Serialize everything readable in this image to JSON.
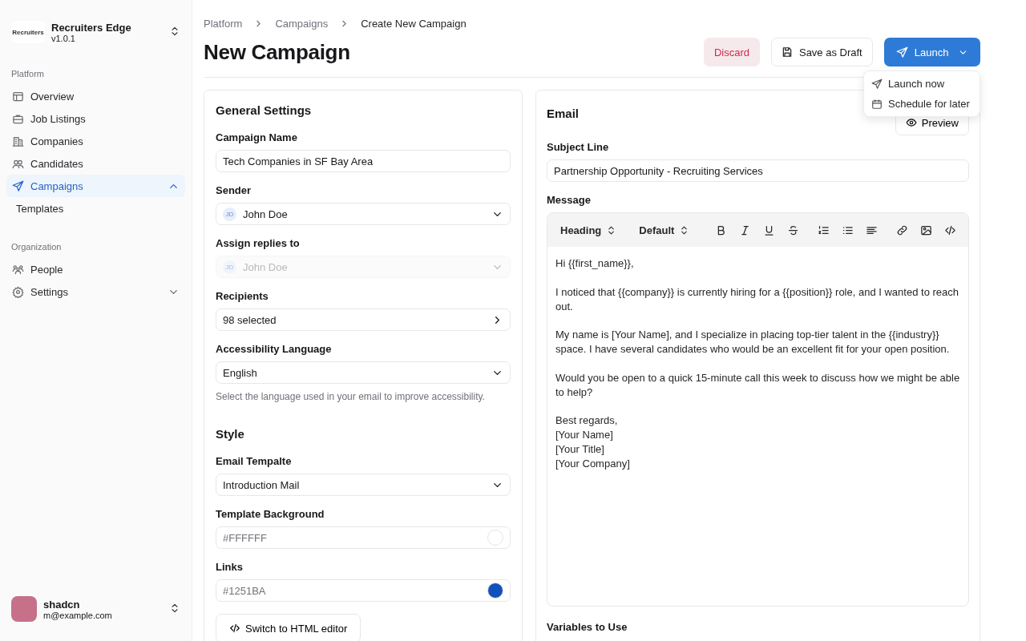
{
  "sidebar": {
    "team": {
      "logo_text": "Recruiters",
      "name": "Recruiters Edge",
      "version": "v1.0.1"
    },
    "groups": [
      {
        "label": "Platform",
        "items": [
          {
            "label": "Overview",
            "selected": false
          },
          {
            "label": "Job Listings",
            "selected": false
          },
          {
            "label": "Companies",
            "selected": false
          },
          {
            "label": "Candidates",
            "selected": false
          },
          {
            "label": "Campaigns",
            "selected": true,
            "expanded": true,
            "children": [
              {
                "label": "Templates",
                "selected": false
              }
            ]
          }
        ]
      },
      {
        "label": "Organization",
        "items": [
          {
            "label": "People",
            "selected": false
          },
          {
            "label": "Settings",
            "selected": false,
            "expanded": false
          }
        ]
      }
    ],
    "user": {
      "name": "shadcn",
      "email": "m@example.com"
    }
  },
  "breadcrumb": [
    "Platform",
    "Campaigns",
    "Create New Campaign"
  ],
  "title": "New Campaign",
  "actions": {
    "discard": "Discard",
    "save": "Save as Draft",
    "launch": {
      "label": "Launch",
      "expanded": true,
      "menu": [
        {
          "label": "Launch now"
        },
        {
          "label": "Schedule for later"
        }
      ]
    }
  },
  "general": {
    "title": "General Settings",
    "fields": [
      {
        "kind": "input",
        "label": "Campaign Name",
        "value": "Tech Companies in SF Bay Area",
        "disabled": false
      },
      {
        "kind": "select",
        "label": "Sender",
        "avatar": "JD",
        "value": "John Doe",
        "disabled": false
      },
      {
        "kind": "select",
        "label": "Assign replies to",
        "avatar": "JD",
        "value": "John Doe",
        "disabled": true
      },
      {
        "kind": "picker",
        "label": "Recipients",
        "value": "98 selected",
        "disabled": false
      },
      {
        "kind": "select",
        "label": "Accessibility Language",
        "value": "English",
        "hint": "Select the language used in your email to improve accessibility.",
        "disabled": false
      }
    ]
  },
  "style": {
    "title": "Style",
    "fields": [
      {
        "kind": "select",
        "label": "Email Tempalte",
        "value": "Introduction Mail",
        "disabled": false
      },
      {
        "kind": "color",
        "label": "Template Background",
        "placeholder": "#FFFFFF",
        "color": "#ffffff",
        "disabled": false
      },
      {
        "kind": "color",
        "label": "Links",
        "placeholder": "#1251BA",
        "color": "#1251ba",
        "disabled": false
      }
    ],
    "html_button": "Switch to HTML editor"
  },
  "email": {
    "title": "Email",
    "preview": "Preview",
    "subject_label": "Subject Line",
    "subject": "Partnership Opportunity - Recruiting Services",
    "message_label": "Message",
    "toolbar": {
      "selects": [
        "Heading",
        "Default"
      ]
    },
    "paragraphs": [
      [
        "Hi {{first_name}},"
      ],
      [
        "I noticed that {{company}} is currently hiring for a {{position}} role, and I wanted to reach out."
      ],
      [
        "My name is [Your Name], and I specialize in placing top-tier talent in the {{industry}} space. I have several candidates who would be an excellent fit for your open position."
      ],
      [
        "Would you be open to a quick 15-minute call this week to discuss how we might be able to help?"
      ],
      [
        "Best regards,",
        "[Your Name]",
        "[Your Title]",
        "[Your Company]"
      ]
    ],
    "variables_label": "Variables to Use"
  }
}
